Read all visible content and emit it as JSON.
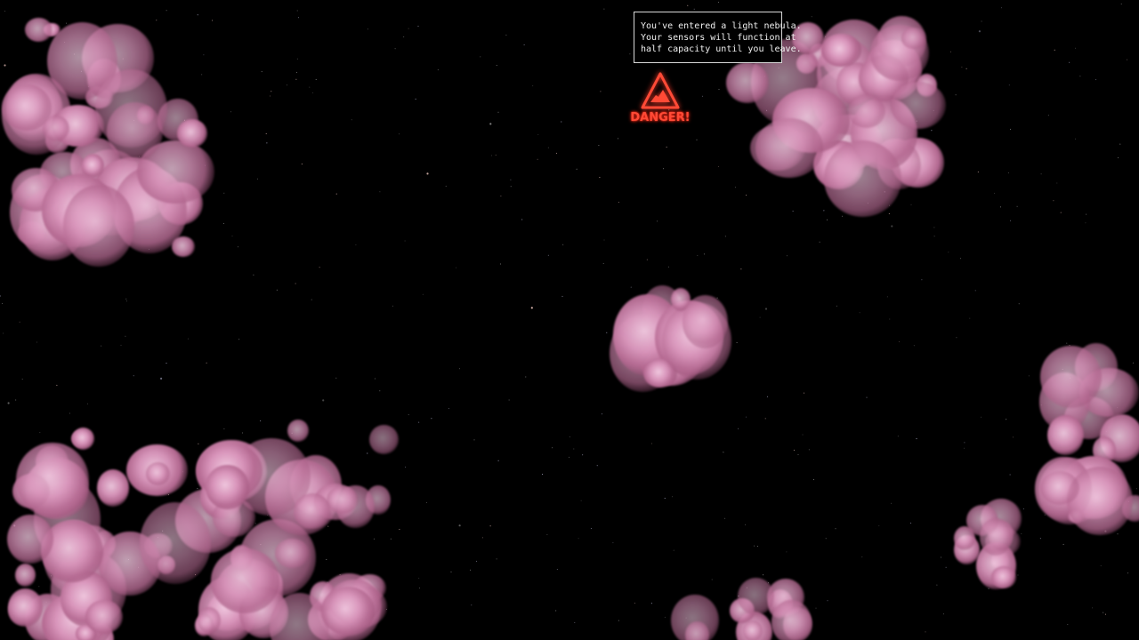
{
  "scene": {
    "background_color": "#000000",
    "nebula_color": "#d995bb"
  },
  "tooltip": {
    "lines": [
      "You've entered a light nebula.",
      "Your sensors will function at",
      "half capacity until you leave."
    ]
  },
  "danger": {
    "label": "DANGER!",
    "icon": "hazard-triangle-icon",
    "color": "#ff4a36"
  }
}
